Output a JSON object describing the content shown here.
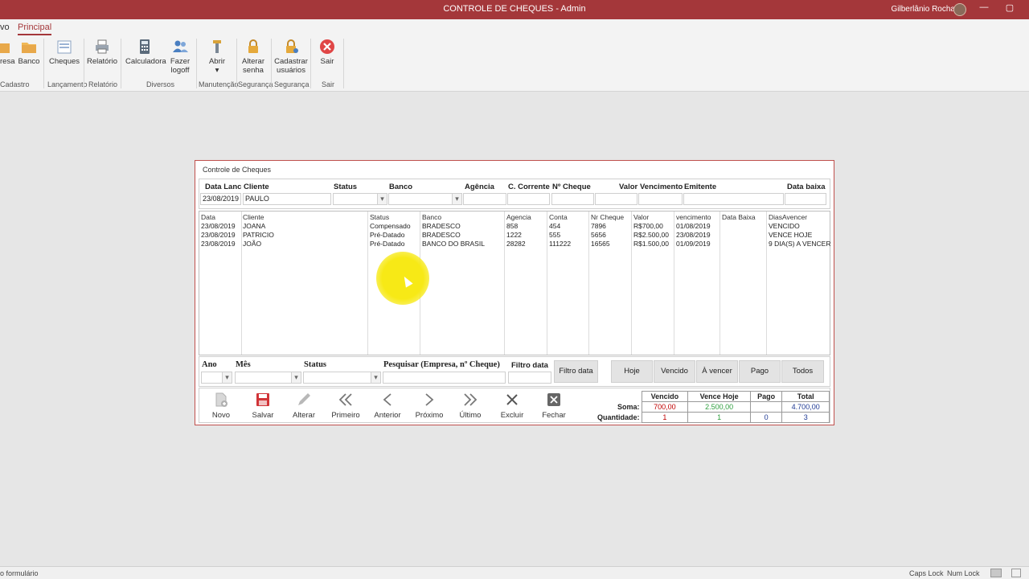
{
  "window": {
    "title": "CONTROLE DE CHEQUES - Admin",
    "user": "Gilberlânio Rocha",
    "controls": [
      "—",
      "▢"
    ]
  },
  "ribbon": {
    "tabs": [
      {
        "label": "vo"
      },
      {
        "label": "Principal"
      }
    ],
    "buttons": [
      {
        "label": "resa"
      },
      {
        "label": "Banco"
      },
      {
        "label": "Cheques"
      },
      {
        "label": "Relatório"
      },
      {
        "label": "Calculadora"
      },
      {
        "label": "Fazer logoff"
      },
      {
        "label": "Abrir"
      },
      {
        "label": "Alterar senha"
      },
      {
        "label": "Cadastrar usuários"
      },
      {
        "label": "Sair"
      }
    ],
    "groups": [
      "Cadastro",
      "Lançamento",
      "Relatório",
      "Diversos",
      "Manutenção",
      "Segurança",
      "Segurança",
      "Sair"
    ]
  },
  "form": {
    "title": "Controle de Cheques",
    "filter_labels": {
      "data_lanc": "Data Lanc",
      "cliente": "Cliente",
      "status": "Status",
      "banco": "Banco",
      "agencia": "Agência",
      "c_corrente": "C. Corrente",
      "n_cheque": "Nº Cheque",
      "valor": "Valor",
      "vencimento": "Vencimento",
      "emitente": "Emitente",
      "data_baixa": "Data baixa"
    },
    "filter_values": {
      "data_lanc": "23/08/2019",
      "cliente": "PAULO"
    },
    "list_headers": [
      "Data",
      "Cliente",
      "Status",
      "Banco",
      "Agencia",
      "Conta",
      "Nr Cheque",
      "Valor",
      "vencimento",
      "Data Baixa",
      "DiasAvencer"
    ],
    "rows": [
      [
        "23/08/2019",
        "JOANA",
        "Compensado",
        "BRADESCO",
        "858",
        "454",
        "7896",
        "R$700,00",
        "01/08/2019",
        "",
        "VENCIDO"
      ],
      [
        "23/08/2019",
        "PATRICIO",
        "Pré-Datado",
        "BRADESCO",
        "1222",
        "555",
        "5656",
        "R$2.500,00",
        "23/08/2019",
        "",
        "VENCE HOJE"
      ],
      [
        "23/08/2019",
        "JOÃO",
        "Pré-Datado",
        "BANCO DO BRASIL",
        "28282",
        "111222",
        "16565",
        "R$1.500,00",
        "01/09/2019",
        "",
        "9  DIA(S) A VENCER"
      ]
    ],
    "bottom_labels": {
      "ano": "Ano",
      "mes": "Mês",
      "status": "Status",
      "pesquisar": "Pesquisar (Empresa, nº Cheque)",
      "filtro_data": "Filtro data"
    },
    "filter_button": "Filtro data",
    "quick_buttons": [
      "Hoje",
      "Vencido",
      "À vencer",
      "Pago",
      "Todos"
    ],
    "actions": [
      "Novo",
      "Salvar",
      "Alterar",
      "Primeiro",
      "Anterior",
      "Próximo",
      "Último",
      "Excluir",
      "Fechar"
    ],
    "totals": {
      "headers": [
        "Vencido",
        "Vence Hoje",
        "Pago",
        "Total"
      ],
      "soma_label": "Soma:",
      "soma": [
        "700,00",
        "2.500,00",
        "",
        "4.700,00"
      ],
      "quantidade_label": "Quantidade:",
      "quantidade": [
        "1",
        "1",
        "0",
        "3"
      ],
      "colors": {
        "vencido": "#c00000",
        "vence_hoje": "#2e9e3e",
        "pago": "#1f3a93",
        "total": "#1f3a93"
      }
    }
  },
  "statusbar": {
    "left": "o formulário",
    "caps": "Caps Lock",
    "num": "Num Lock"
  }
}
